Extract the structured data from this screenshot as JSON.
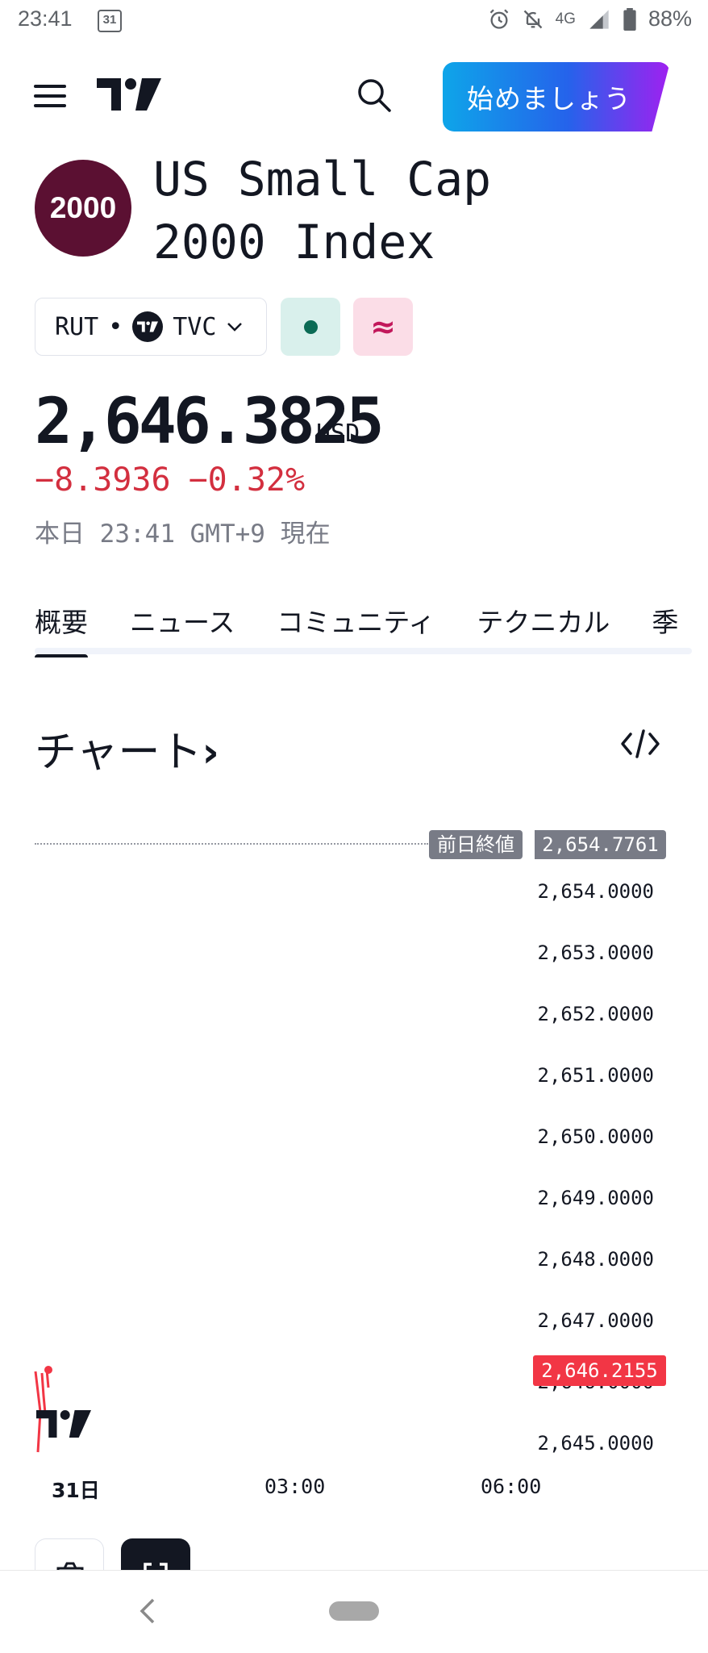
{
  "status_bar": {
    "time": "23:41",
    "calendar_day": "31",
    "network": "4G",
    "battery": "88%"
  },
  "header": {
    "cta_label": "始めましょう"
  },
  "symbol": {
    "logo_text": "2000",
    "title": "US Small Cap 2000 Index",
    "ticker": "RUT",
    "separator": "•",
    "exchange": "TVC",
    "delay_glyph": "≈",
    "price": "2,646.3825",
    "currency": "USD",
    "change_abs": "−8.3936",
    "change_pct": "−0.32%",
    "as_of": "本日 23:41 GMT+9 現在"
  },
  "tabs": [
    "概要",
    "ニュース",
    "コミュニティ",
    "テクニカル",
    "季"
  ],
  "chart_section": {
    "heading": "チャート",
    "heading_arrow": "›"
  },
  "chart_data": {
    "type": "line",
    "prev_close_label": "前日終値",
    "prev_close": "2,654.7761",
    "current_value": "2,646.2155",
    "y_ticks": [
      "2,654.0000",
      "2,653.0000",
      "2,652.0000",
      "2,651.0000",
      "2,650.0000",
      "2,649.0000",
      "2,648.0000",
      "2,647.0000",
      "2,646.0000",
      "2,645.0000"
    ],
    "x_ticks": [
      "31日",
      "03:00",
      "06:00"
    ],
    "colors": {
      "line": "#f23645",
      "prev_close": "#787b86",
      "current_tag": "#f23645"
    }
  },
  "colors": {
    "negative": "#d32f3f",
    "brand_dark": "#131722",
    "symbol_logo_bg": "#5b1032"
  }
}
